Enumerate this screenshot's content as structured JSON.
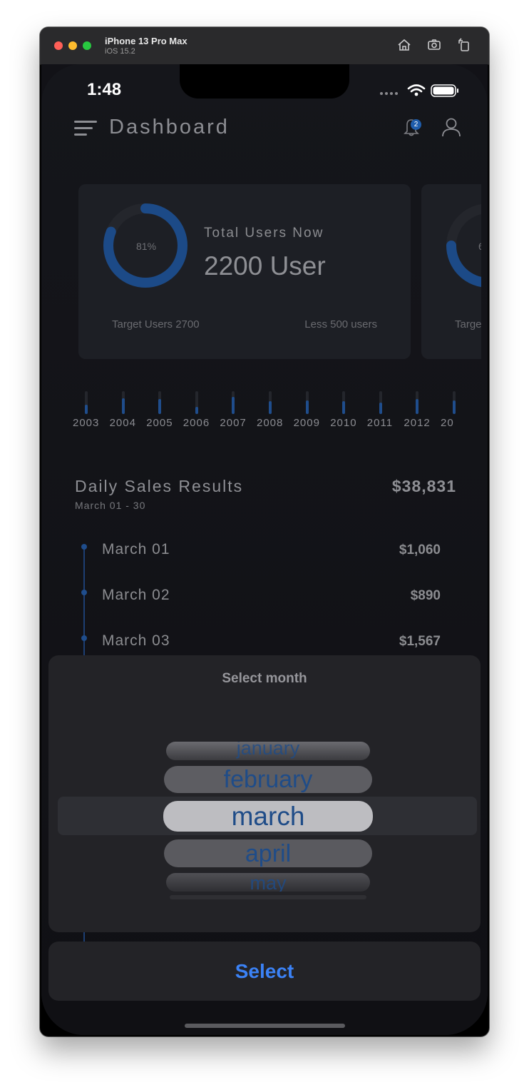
{
  "window": {
    "title": "iPhone 13 Pro Max",
    "subtitle": "iOS 15.2",
    "lights": [
      "#fe5f57",
      "#febc2e",
      "#28c840"
    ]
  },
  "status": {
    "time": "1:48"
  },
  "appbar": {
    "title": "Dashboard",
    "notification_count": "2"
  },
  "cards": [
    {
      "percent": "81%",
      "progress": 0.81,
      "heading": "Total Users Now",
      "value": "2200 User",
      "target": "Target Users 2700",
      "remaining": "Less 500 users"
    },
    {
      "percent": "6",
      "heading": "",
      "value": "",
      "target": "Targe",
      "remaining": ""
    }
  ],
  "years": [
    {
      "label": "2003",
      "level": 0.4
    },
    {
      "label": "2004",
      "level": 0.7
    },
    {
      "label": "2005",
      "level": 0.65
    },
    {
      "label": "2006",
      "level": 0.3
    },
    {
      "label": "2007",
      "level": 0.75
    },
    {
      "label": "2008",
      "level": 0.55
    },
    {
      "label": "2009",
      "level": 0.6
    },
    {
      "label": "2010",
      "level": 0.55
    },
    {
      "label": "2011",
      "level": 0.5
    },
    {
      "label": "2012",
      "level": 0.65
    },
    {
      "label": "20",
      "level": 0.6
    }
  ],
  "sales": {
    "title": "Daily Sales Results",
    "range": "March 01 - 30",
    "total": "$38,831",
    "rows": [
      {
        "label": "March 01",
        "value": "$1,060"
      },
      {
        "label": "March 02",
        "value": "$890"
      },
      {
        "label": "March 03",
        "value": "$1,567"
      }
    ]
  },
  "picker": {
    "title": "Select month",
    "months": [
      "january",
      "february",
      "march",
      "april",
      "may"
    ],
    "selected": "march",
    "button_label": "Select"
  },
  "colors": {
    "accent": "#1f4d8c",
    "button_text": "#3b82f6",
    "background": "#121217",
    "card": "#1d1f25"
  }
}
